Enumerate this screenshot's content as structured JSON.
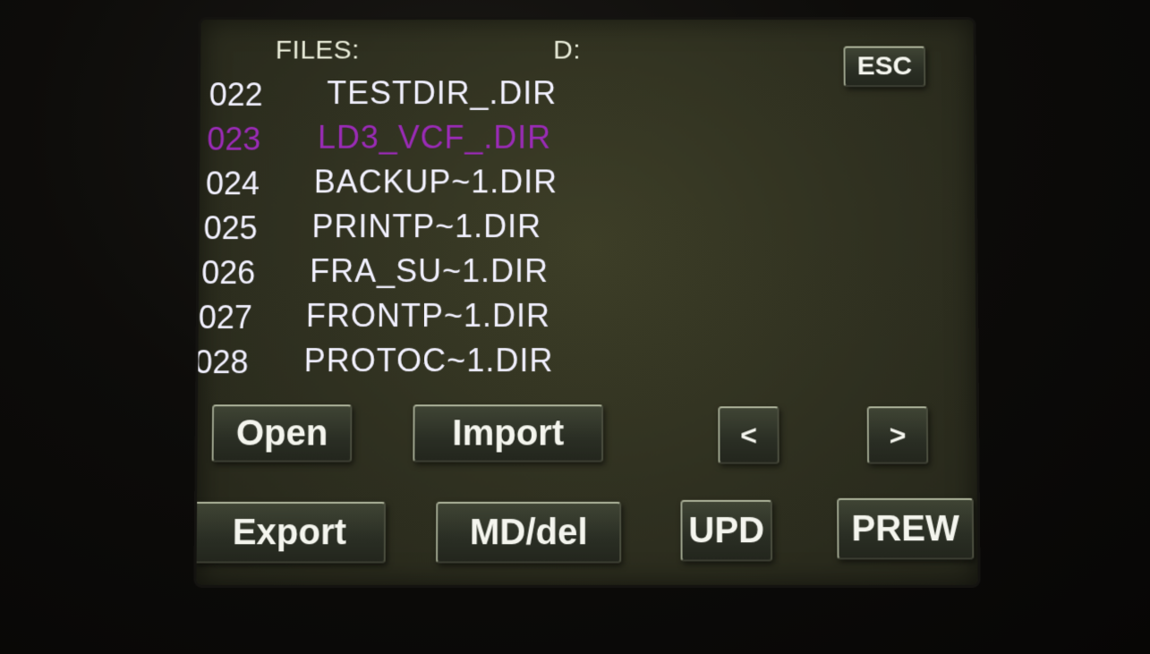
{
  "header": {
    "files_label": "FILES:",
    "drive_label": "D:",
    "esc_label": "ESC"
  },
  "file_list": [
    {
      "index": "022",
      "name": "TESTDIR_.DIR",
      "selected": false
    },
    {
      "index": "023",
      "name": "LD3_VCF_.DIR",
      "selected": true
    },
    {
      "index": "024",
      "name": "BACKUP~1.DIR",
      "selected": false
    },
    {
      "index": "025",
      "name": "PRINTP~1.DIR",
      "selected": false
    },
    {
      "index": "026",
      "name": "FRA_SU~1.DIR",
      "selected": false
    },
    {
      "index": "027",
      "name": "FRONTP~1.DIR",
      "selected": false
    },
    {
      "index": "028",
      "name": "PROTOC~1.DIR",
      "selected": false
    }
  ],
  "buttons": {
    "open": "Open",
    "import": "Import",
    "prev": "<",
    "next": ">",
    "export": "Export",
    "md_del": "MD/del",
    "upd": "UPD",
    "prew": "PREW"
  },
  "colors": {
    "text": "#f2f1ff",
    "selected": "#9a2bb6",
    "screen_bg": "#34351f"
  }
}
